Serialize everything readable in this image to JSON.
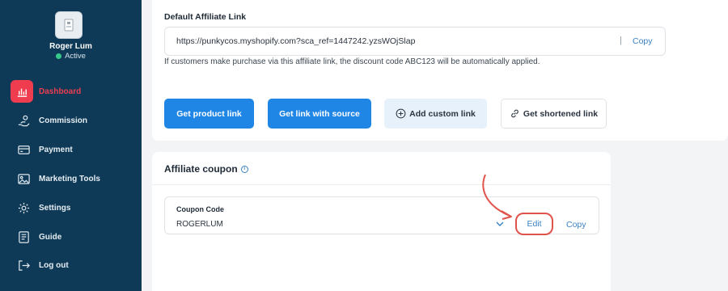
{
  "user": {
    "name": "Roger Lum",
    "status": "Active"
  },
  "sidebar": {
    "items": [
      {
        "label": "Dashboard",
        "icon": "chart-icon",
        "active": true
      },
      {
        "label": "Commission",
        "icon": "hand-coin-icon"
      },
      {
        "label": "Payment",
        "icon": "credit-card-icon"
      },
      {
        "label": "Marketing Tools",
        "icon": "image-icon"
      },
      {
        "label": "Settings",
        "icon": "gear-icon"
      },
      {
        "label": "Guide",
        "icon": "book-icon"
      },
      {
        "label": "Log out",
        "icon": "logout-icon"
      }
    ]
  },
  "affiliate_link": {
    "section_label": "Default Affiliate Link",
    "url": "https://punkycos.myshopify.com?sca_ref=1447242.yzsWOjSlap",
    "separator": "|",
    "copy_label": "Copy",
    "help_text": "If customers make purchase via this affiliate link, the discount code ABC123 will be automatically applied."
  },
  "actions": {
    "get_product_link": "Get product link",
    "get_link_with_source": "Get link with source",
    "add_custom_link": "Add custom link",
    "get_shortened_link": "Get shortened link"
  },
  "coupon": {
    "title": "Affiliate coupon",
    "info_glyph": "i",
    "code_label": "Coupon Code",
    "code_value": "ROGERLUM",
    "edit_label": "Edit",
    "copy_label": "Copy"
  },
  "colors": {
    "sidebar_bg": "#0e3a58",
    "accent_red": "#ef3d4f",
    "primary_blue": "#1f86e6",
    "link_blue": "#3b82c4",
    "annotation_red": "#e0534a",
    "status_green": "#36c98a"
  }
}
